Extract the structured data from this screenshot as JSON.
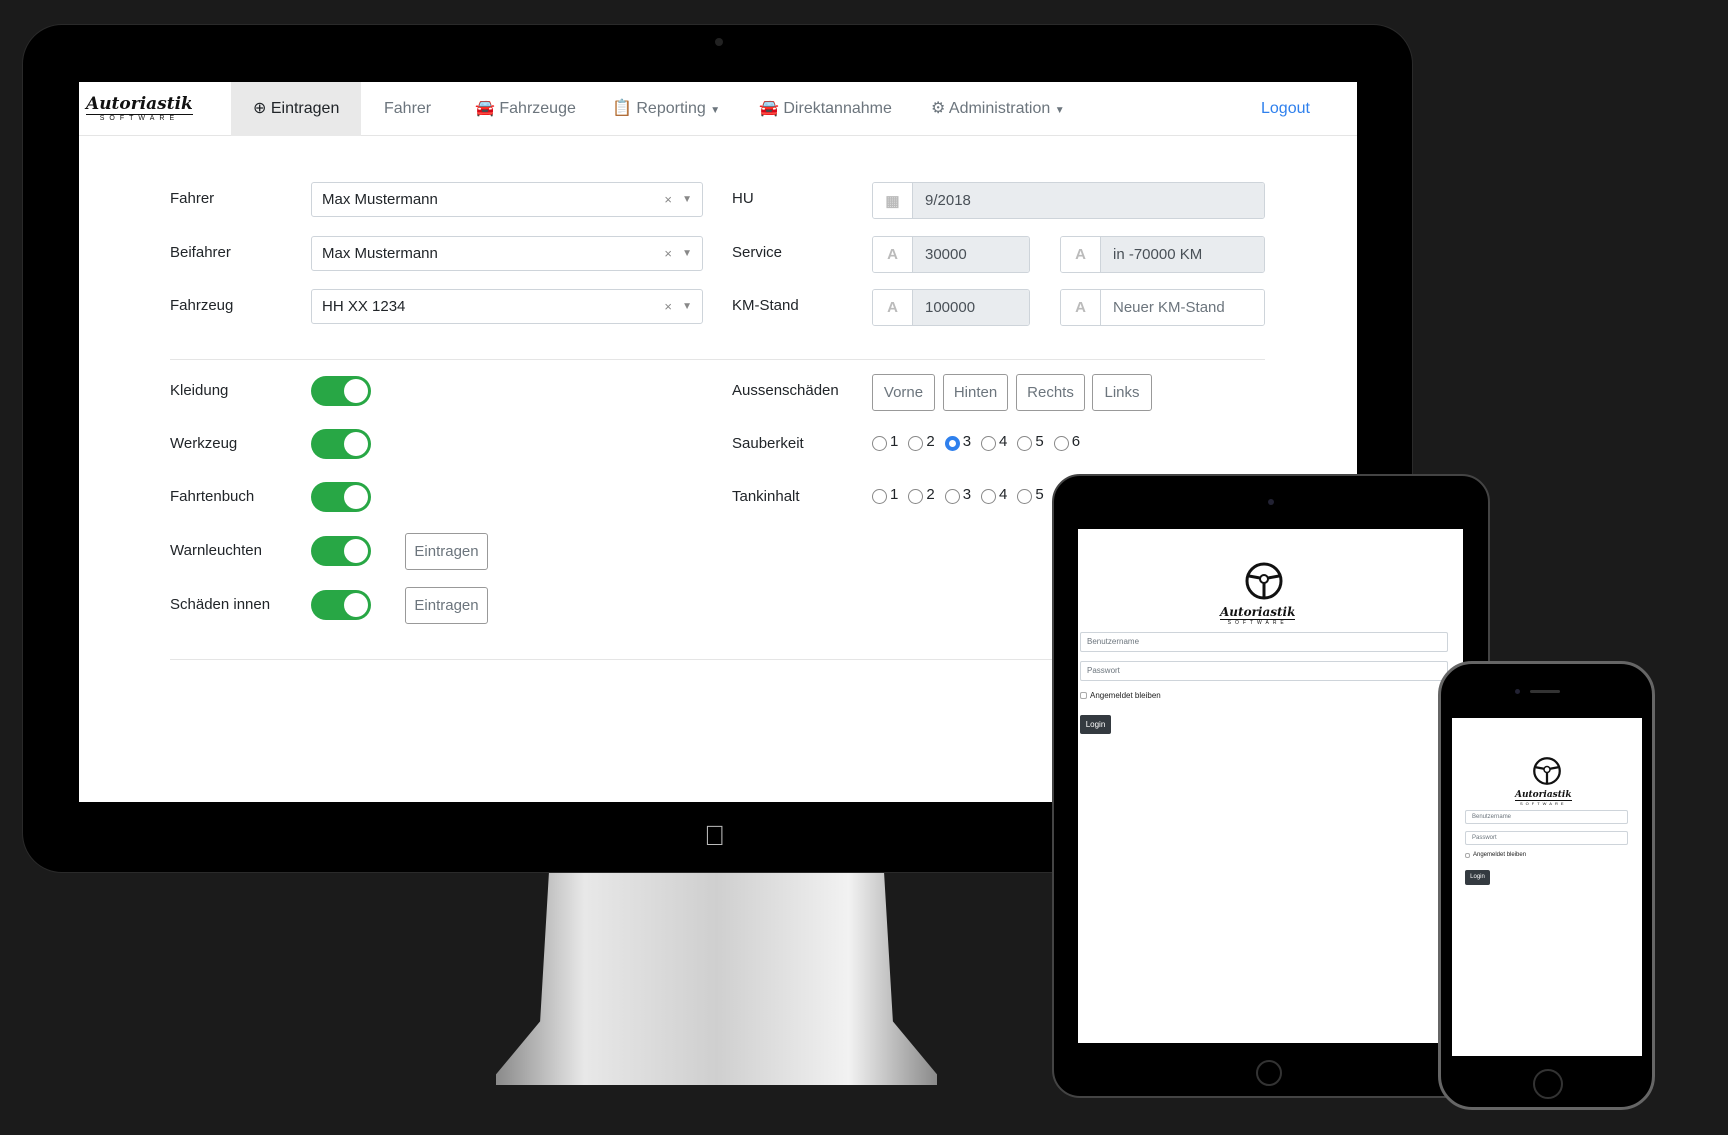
{
  "desktop": {
    "logo": {
      "name": "Autoriastik",
      "sub": "SOFTWARE"
    },
    "nav": [
      {
        "label": "Eintragen",
        "icon": "plus-circle-icon",
        "active": true
      },
      {
        "label": "Fahrer"
      },
      {
        "label": "Fahrzeuge",
        "icon": "car-icon"
      },
      {
        "label": "Reporting",
        "icon": "clipboard-icon",
        "dropdown": true
      },
      {
        "label": "Direktannahme",
        "icon": "car-icon"
      },
      {
        "label": "Administration",
        "icon": "gear-icon",
        "dropdown": true
      }
    ],
    "logout": "Logout",
    "form": {
      "fahrer": {
        "label": "Fahrer",
        "value": "Max Mustermann"
      },
      "beifahrer": {
        "label": "Beifahrer",
        "value": "Max Mustermann"
      },
      "fahrzeug": {
        "label": "Fahrzeug",
        "value": "HH XX 1234"
      },
      "clear": "×",
      "hu": {
        "label": "HU",
        "value": "9/2018"
      },
      "service": {
        "label": "Service",
        "value": "30000",
        "remaining": "in -70000 KM"
      },
      "km": {
        "label": "KM-Stand",
        "value": "100000",
        "placeholder": "Neuer KM-Stand"
      },
      "toggles": [
        {
          "label": "Kleidung",
          "on": true
        },
        {
          "label": "Werkzeug",
          "on": true
        },
        {
          "label": "Fahrtenbuch",
          "on": true
        },
        {
          "label": "Warnleuchten",
          "on": true,
          "button": "Eintragen"
        },
        {
          "label": "Schäden innen",
          "on": true,
          "button": "Eintragen"
        }
      ],
      "aussen": {
        "label": "Aussenschäden",
        "buttons": [
          "Vorne",
          "Hinten",
          "Rechts",
          "Links"
        ]
      },
      "sauberkeit": {
        "label": "Sauberkeit",
        "options": [
          "1",
          "2",
          "3",
          "4",
          "5",
          "6"
        ],
        "selected": "3"
      },
      "tankinhalt": {
        "label": "Tankinhalt",
        "options": [
          "1",
          "2",
          "3",
          "4",
          "5"
        ]
      }
    }
  },
  "login": {
    "logo": {
      "name": "Autoriastik",
      "sub": "SOFTWARE"
    },
    "username_placeholder": "Benutzername",
    "password_placeholder": "Passwort",
    "remember": "Angemeldet bleiben",
    "button": "Login"
  },
  "colors": {
    "accent": "#2f80ed",
    "toggle": "#28a745",
    "login_button": "#343a40"
  }
}
